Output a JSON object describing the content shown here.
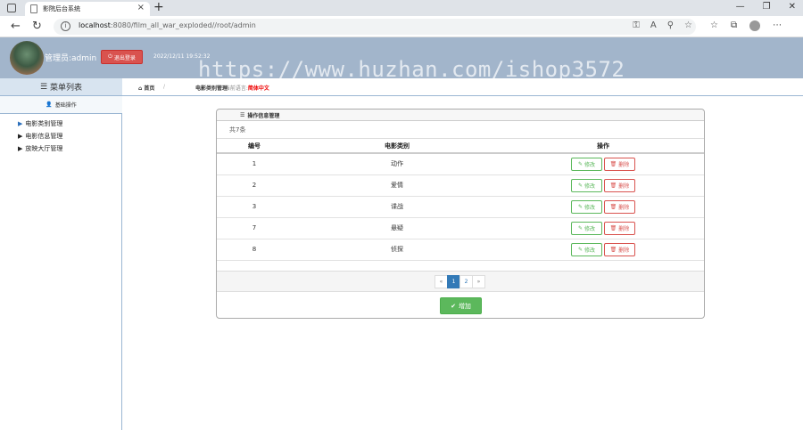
{
  "browser": {
    "tab_title": "影院后台系统",
    "url_host": "localhost",
    "url_path": ":8080/film_all_war_exploded//root/admin"
  },
  "header": {
    "admin_label": "管理员:admin",
    "logout_label": "退出登录",
    "datetime": "2022/12/11 19:52:32",
    "watermark": "https://www.huzhan.com/ishop3572"
  },
  "sidebar": {
    "menu_title": "菜单列表",
    "section_title": "基础操作",
    "items": [
      {
        "label": "电影类别管理"
      },
      {
        "label": "电影信息管理"
      },
      {
        "label": "放映大厅管理"
      }
    ]
  },
  "breadcrumb": {
    "home": "首页",
    "current": "电影类别管理",
    "lang_prefix": "当前语言:",
    "lang_value": "简体中文"
  },
  "panel": {
    "title": "操作信息管理",
    "count": "共7条",
    "columns": [
      "编号",
      "电影类别",
      "操作"
    ],
    "rows": [
      {
        "id": "1",
        "name": "动作"
      },
      {
        "id": "2",
        "name": "爱情"
      },
      {
        "id": "3",
        "name": "谍战"
      },
      {
        "id": "7",
        "name": "悬疑"
      },
      {
        "id": "8",
        "name": "侦探"
      }
    ],
    "edit_label": "修改",
    "delete_label": "删除",
    "pager": [
      "«",
      "1",
      "2",
      "»"
    ],
    "add_label": "增加"
  }
}
